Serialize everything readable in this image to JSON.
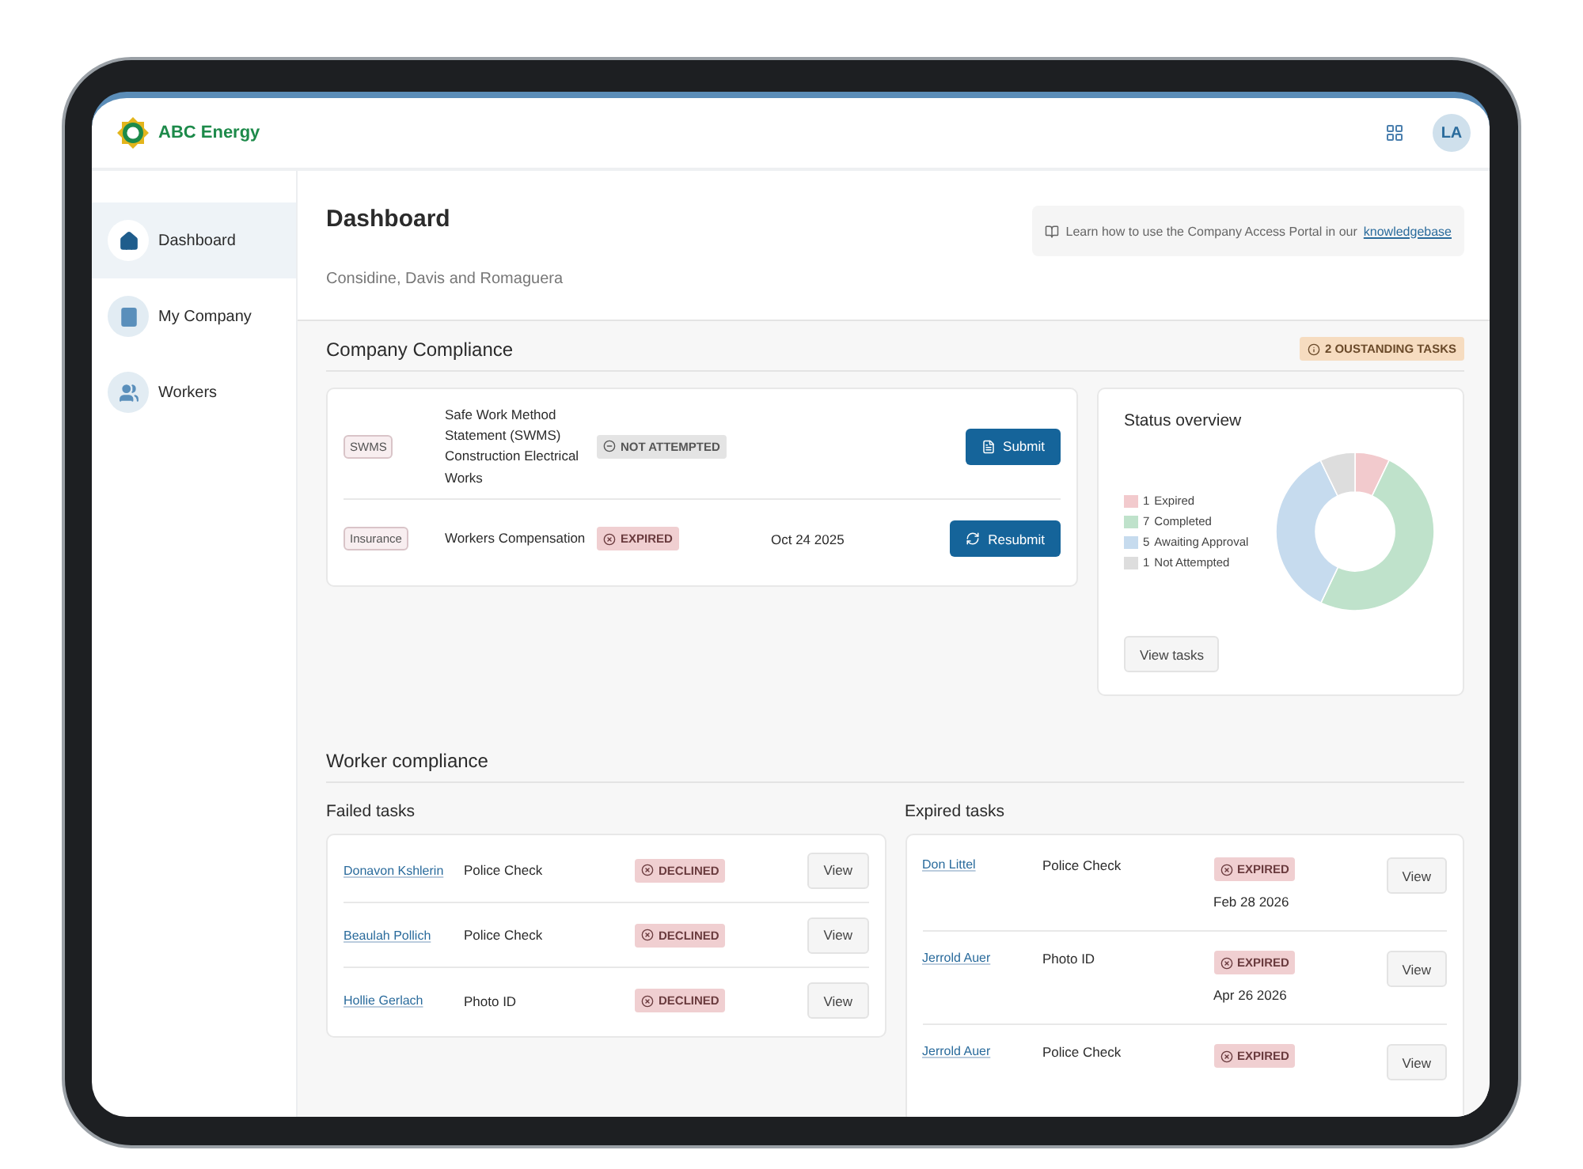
{
  "brand": {
    "name": "ABC Energy"
  },
  "user": {
    "initials": "LA"
  },
  "sidebar": {
    "items": [
      {
        "label": "Dashboard",
        "selected": true
      },
      {
        "label": "My Company",
        "selected": false
      },
      {
        "label": "Workers",
        "selected": false
      }
    ]
  },
  "page": {
    "title": "Dashboard",
    "subtitle": "Considine, Davis and Romaguera",
    "help_text": "Learn how to use the Company Access Portal in our",
    "help_link": "knowledgebase"
  },
  "company_compliance": {
    "title": "Company Compliance",
    "badge": "2 OUSTANDING TASKS",
    "rows": [
      {
        "tag": "SWMS",
        "name": "Safe Work Method Statement (SWMS) Construction Electrical Works",
        "status": {
          "label": "NOT ATTEMPTED",
          "kind": "not_attempted"
        },
        "action": {
          "label": "Submit",
          "kind": "submit"
        }
      },
      {
        "tag": "Insurance",
        "name": "Workers Compensation",
        "status": {
          "label": "EXPIRED",
          "kind": "expired"
        },
        "date": "Oct 24 2025",
        "action": {
          "label": "Resubmit",
          "kind": "resubmit"
        }
      }
    ]
  },
  "status_overview": {
    "title": "Status overview",
    "button": "View tasks",
    "legend": [
      {
        "count": "1",
        "label": "Expired",
        "color": "#f2cacd"
      },
      {
        "count": "7",
        "label": "Completed",
        "color": "#bfe2cb"
      },
      {
        "count": "5",
        "label": "Awaiting Approval",
        "color": "#c6dbee"
      },
      {
        "count": "1",
        "label": "Not Attempted",
        "color": "#dddddd"
      }
    ],
    "chart_data": {
      "type": "donut",
      "values": [
        7.1,
        50,
        35.7,
        7.2
      ]
    }
  },
  "worker_compliance": {
    "title": "Worker compliance",
    "failed": {
      "title": "Failed tasks",
      "rows": [
        {
          "worker": "Donavon Kshlerin",
          "task": "Police Check",
          "status": {
            "label": "DECLINED",
            "kind": "declined"
          },
          "button": "View"
        },
        {
          "worker": "Beaulah Pollich",
          "task": "Police Check",
          "status": {
            "label": "DECLINED",
            "kind": "declined"
          },
          "button": "View"
        },
        {
          "worker": "Hollie Gerlach",
          "task": "Photo ID",
          "status": {
            "label": "DECLINED",
            "kind": "declined"
          },
          "button": "View"
        }
      ]
    },
    "expired": {
      "title": "Expired tasks",
      "rows": [
        {
          "worker": "Don Littel",
          "task": "Police Check",
          "status": {
            "label": "EXPIRED",
            "kind": "expired"
          },
          "date": "Feb 28 2026",
          "button": "View"
        },
        {
          "worker": "Jerrold Auer",
          "task": "Photo ID",
          "status": {
            "label": "EXPIRED",
            "kind": "expired"
          },
          "date": "Apr 26 2026",
          "button": "View"
        },
        {
          "worker": "Jerrold Auer",
          "task": "Police Check",
          "status": {
            "label": "EXPIRED",
            "kind": "expired"
          },
          "button": "View"
        }
      ]
    }
  }
}
